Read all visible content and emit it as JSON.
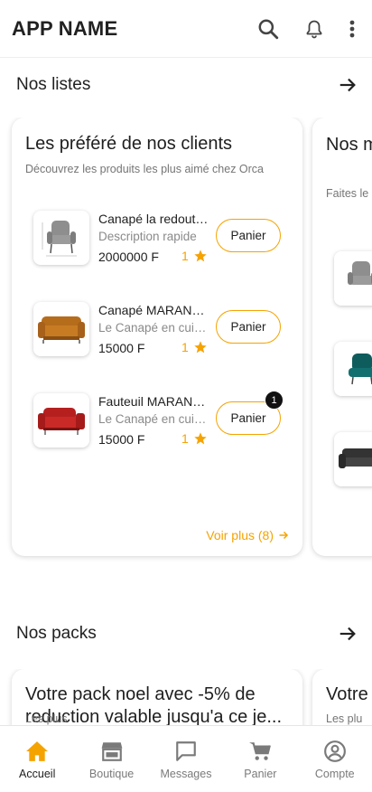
{
  "app_bar": {
    "title": "APP NAME"
  },
  "lists_section": {
    "title": "Nos listes",
    "cards": [
      {
        "title": "Les préféré de nos clients",
        "subtitle": "Découvrez les produits les plus aimé chez Orca",
        "see_more": "Voir plus (8)",
        "products": [
          {
            "name": "Canapé la redoute interieurs",
            "description": "Description rapide",
            "price": "2000000 F",
            "rating": "1",
            "cart_label": "Panier",
            "image": "grey-armchair"
          },
          {
            "name": "Canapé MARANELLO",
            "description": "Le Canapé en cuir marron",
            "price": "15000 F",
            "rating": "1",
            "cart_label": "Panier",
            "image": "tan-leather-sofa"
          },
          {
            "name": "Fauteuil MARANELLO",
            "description": "Le Canapé en cuir rouge",
            "price": "15000 F",
            "rating": "1",
            "cart_label": "Panier",
            "cart_count": "1",
            "image": "red-leather-sofa"
          }
        ]
      },
      {
        "title": "Nos meilleurs salons",
        "subtitle": "Faites le bon choix pour vous avec nos salons",
        "images": [
          "grey-armchair",
          "teal-armchair",
          "black-sofa"
        ]
      }
    ]
  },
  "packs_section": {
    "title": "Nos packs",
    "cards": [
      {
        "title": "Votre pack noel avec -5% de reduction valable jusqu'a ce je...",
        "subtitle": "Les plus"
      },
      {
        "title": "Votre",
        "subtitle": "Les plu"
      }
    ]
  },
  "bottom_nav": {
    "items": [
      {
        "label": "Accueil",
        "icon": "home-icon",
        "active": true
      },
      {
        "label": "Boutique",
        "icon": "store-icon"
      },
      {
        "label": "Messages",
        "icon": "chat-icon"
      },
      {
        "label": "Panier",
        "icon": "cart-icon"
      },
      {
        "label": "Compte",
        "icon": "account-icon"
      }
    ]
  },
  "colors": {
    "accent": "#f5a300",
    "text": "#212121",
    "muted": "#757575",
    "badge": "#111111"
  }
}
